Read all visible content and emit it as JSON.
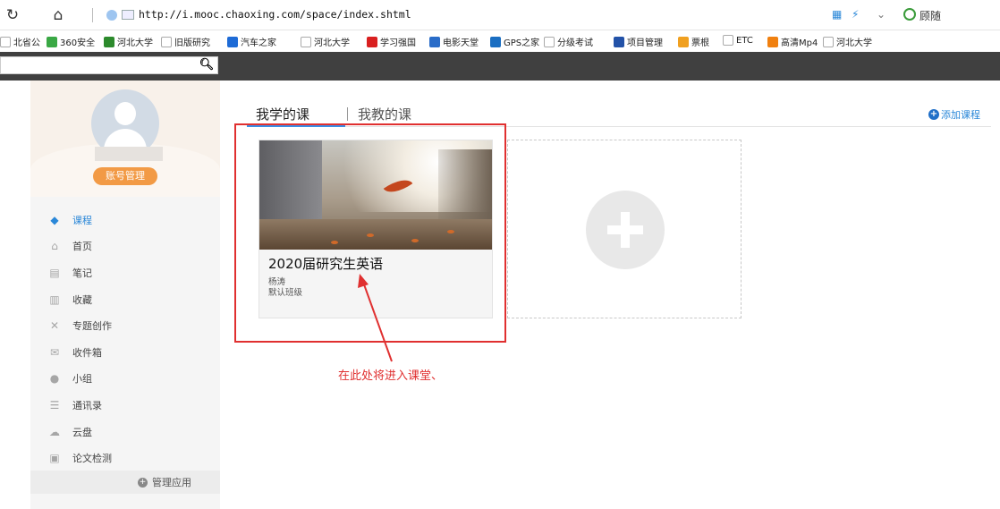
{
  "browser": {
    "url": "http://i.mooc.chaoxing.com/space/index.shtml",
    "search_text": "顾随"
  },
  "bookmarks": [
    {
      "label": "北省公",
      "color": "#ffffff"
    },
    {
      "label": "360安全",
      "color": "#3aa845"
    },
    {
      "label": "河北大学",
      "color": "#2c8a2c"
    },
    {
      "label": "旧版研究",
      "color": "#ffffff"
    },
    {
      "label": "汽车之家",
      "color": "#1e6bd6"
    },
    {
      "label": "河北大学",
      "color": "#ffffff"
    },
    {
      "label": "学习强国",
      "color": "#d92020"
    },
    {
      "label": "电影天堂",
      "color": "#2a6cc8"
    },
    {
      "label": "GPS之家",
      "color": "#1a6ec2"
    },
    {
      "label": "分级考试",
      "color": "#ffffff"
    },
    {
      "label": "项目管理",
      "color": "#2352a8"
    },
    {
      "label": "票根",
      "color": "#f0a020"
    },
    {
      "label": "ETC",
      "color": "#ffffff"
    },
    {
      "label": "高清Mp4",
      "color": "#f08010"
    },
    {
      "label": "河北大学",
      "color": "#ffffff"
    }
  ],
  "sidebar": {
    "account_button": "账号管理",
    "menu": [
      {
        "label": "课程",
        "icon": "graduation-cap-icon",
        "glyph": "◆",
        "active": true
      },
      {
        "label": "首页",
        "icon": "home-icon",
        "glyph": "⌂",
        "active": false
      },
      {
        "label": "笔记",
        "icon": "note-icon",
        "glyph": "▤",
        "active": false
      },
      {
        "label": "收藏",
        "icon": "book-icon",
        "glyph": "▥",
        "active": false
      },
      {
        "label": "专题创作",
        "icon": "tools-icon",
        "glyph": "✕",
        "active": false
      },
      {
        "label": "收件箱",
        "icon": "inbox-icon",
        "glyph": "✉",
        "active": false
      },
      {
        "label": "小组",
        "icon": "group-icon",
        "glyph": "●",
        "active": false
      },
      {
        "label": "通讯录",
        "icon": "contacts-icon",
        "glyph": "☰",
        "active": false
      },
      {
        "label": "云盘",
        "icon": "cloud-icon",
        "glyph": "☁",
        "active": false
      },
      {
        "label": "论文检测",
        "icon": "document-check-icon",
        "glyph": "▣",
        "active": false
      }
    ],
    "manage_apps": "管理应用"
  },
  "main": {
    "tabs": [
      {
        "label": "我学的课",
        "active": true
      },
      {
        "label": "我教的课",
        "active": false
      }
    ],
    "add_course": "添加课程",
    "course": {
      "title": "2020届研究生英语",
      "teacher": "杨涛",
      "class_name": "默认班级"
    },
    "annotation": "在此处将进入课堂、"
  },
  "colors": {
    "accent": "#2a87d8",
    "account_button": "#f29a45",
    "annotation_red": "#e03030",
    "header_dark": "#404040"
  }
}
